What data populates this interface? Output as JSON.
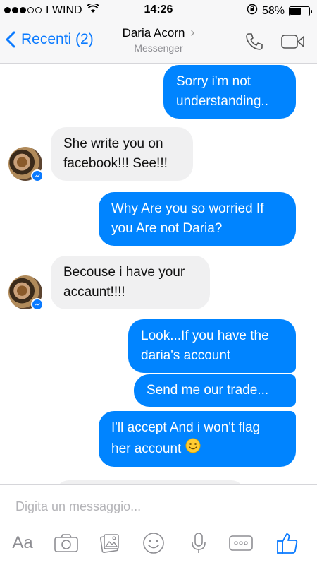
{
  "status_bar": {
    "carrier": "I WIND",
    "time": "14:26",
    "battery_percent": "58%",
    "battery_level": 0.58,
    "signal_bars_filled": 3,
    "signal_bars_total": 5
  },
  "nav": {
    "back_label": "Recenti (2)",
    "contact_name": "Daria Acorn",
    "contact_subtitle": "Messenger",
    "accent_color": "#0a7aff",
    "icons": [
      "phone-icon",
      "video-camera-icon"
    ]
  },
  "messages": [
    {
      "sender": "me",
      "lines": [
        "Sorry i'm not",
        "understanding.."
      ]
    },
    {
      "sender": "contact",
      "lines": [
        "She write you on",
        "facebook!!! See!!!"
      ]
    },
    {
      "sender": "me",
      "lines": [
        "Why Are you so worried If",
        "you Are not Daria?"
      ]
    },
    {
      "sender": "contact",
      "lines": [
        "Becouse i have your",
        "accaunt!!!!"
      ]
    },
    {
      "sender": "me",
      "lines": [
        "Look...If you have the",
        "daria's account"
      ]
    },
    {
      "sender": "me",
      "lines": [
        "Send me our trade..."
      ]
    },
    {
      "sender": "me",
      "lines": [
        "I'll accept And i won't flag",
        "her account"
      ],
      "emoji": "smiley-emoji"
    }
  ],
  "composer": {
    "placeholder": "Digita un messaggio...",
    "text_button_label": "Aa",
    "tools": [
      "text-format",
      "camera-icon",
      "gallery-icon",
      "emoji-icon",
      "microphone-icon",
      "more-icon",
      "like-icon"
    ]
  },
  "colors": {
    "outgoing_bubble": "#0084ff",
    "incoming_bubble": "#f0f0f1",
    "like_button": "#0a7aff"
  }
}
